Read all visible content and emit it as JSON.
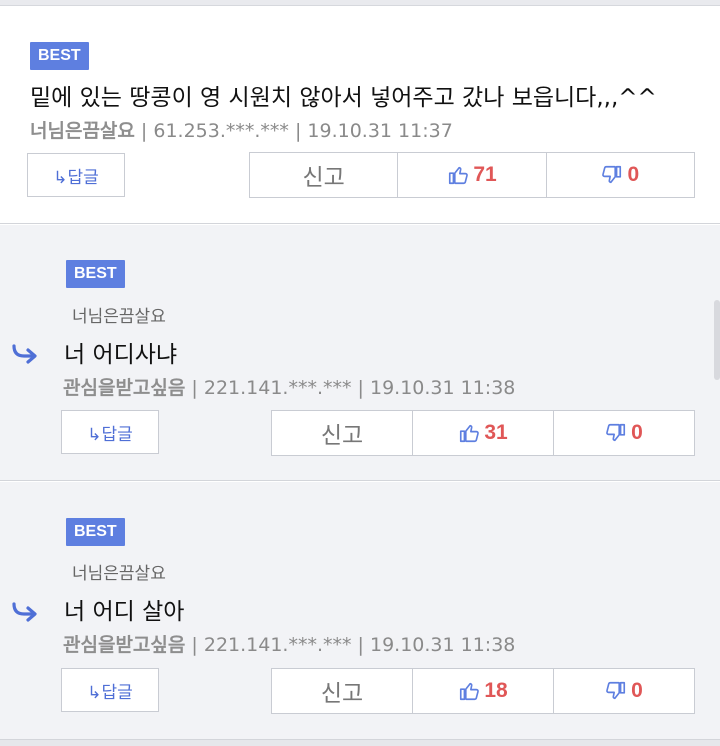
{
  "best_label": "BEST",
  "reply_button_label": "↳답글",
  "report_label": "신고",
  "comments": [
    {
      "text": "밑에 있는 땅콩이 영 시원치 않아서 넣어주고 갔나 보읍니다,,,^^",
      "author": "너님은끔살요",
      "meta": " | 61.253.***.*** | 19.10.31 11:37",
      "upvotes": "71",
      "downvotes": "0"
    },
    {
      "quote_author": "너님은끔살요",
      "text": "너 어디사냐",
      "author": "관심을받고싶음",
      "meta": " | 221.141.***.*** | 19.10.31 11:38",
      "upvotes": "31",
      "downvotes": "0"
    },
    {
      "quote_author": "너님은끔살요",
      "text": "너 어디 살아",
      "author": "관심을받고싶음",
      "meta": " | 221.141.***.*** | 19.10.31 11:38",
      "upvotes": "18",
      "downvotes": "0"
    }
  ],
  "colors": {
    "badge": "#5e7fe0",
    "vote_count": "#e05757",
    "icon": "#5e7fe0",
    "reply_background": "#f2f3f6"
  },
  "icons": [
    "reply-arrow-icon",
    "thumbs-up-icon",
    "thumbs-down-icon"
  ]
}
